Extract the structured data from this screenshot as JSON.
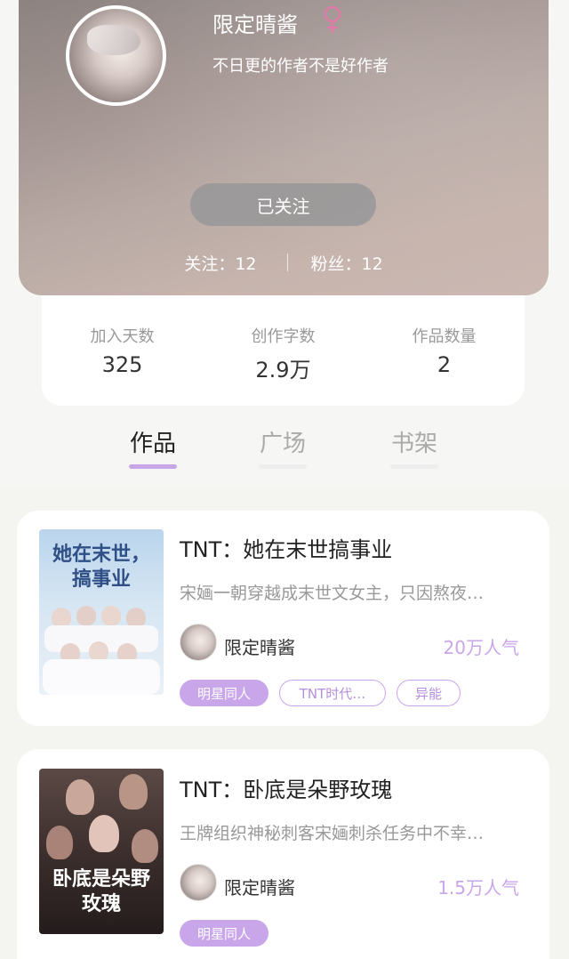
{
  "profile": {
    "name": "限定晴酱",
    "gender_icon": "female-icon",
    "bio": "不日更的作者不是好作者",
    "follow_button": "已关注",
    "following": "关注：12",
    "fans": "粉丝：12"
  },
  "stats": [
    {
      "label": "加入天数",
      "value": "325"
    },
    {
      "label": "创作字数",
      "value": "2.9万"
    },
    {
      "label": "作品数量",
      "value": "2"
    }
  ],
  "tabs": [
    {
      "label": "作品",
      "active": true
    },
    {
      "label": "广场",
      "active": false
    },
    {
      "label": "书架",
      "active": false
    }
  ],
  "books": [
    {
      "title": "TNT：她在末世搞事业",
      "description": "宋婳一朝穿越成末世文女主，只因熬夜…",
      "author": "限定晴酱",
      "popularity": "20万人气",
      "cover_text": "她在末世，搞事业",
      "tags": [
        "明星同人",
        "TNT时代…",
        "异能"
      ]
    },
    {
      "title": "TNT：卧底是朵野玫瑰",
      "description": "王牌组织神秘刺客宋婳刺杀任务中不幸…",
      "author": "限定晴酱",
      "popularity": "1.5万人气",
      "cover_text": "卧底是朵野玫瑰",
      "tags": [
        "明星同人"
      ]
    }
  ],
  "colors": {
    "accent": "#c9a6ea",
    "gender": "#e07aa8"
  }
}
